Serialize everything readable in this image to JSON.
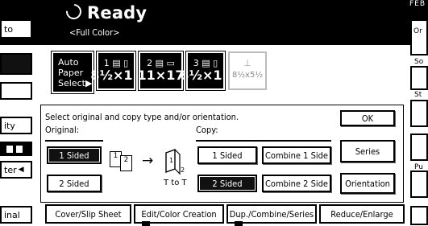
{
  "header": {
    "status": "Ready",
    "color_mode": "<Full Color>",
    "corner_label": "FEB"
  },
  "left_column": {
    "items": [
      "to",
      "",
      "",
      "ity",
      "",
      "ter",
      "inal"
    ]
  },
  "right_column": {
    "top_label": "Or",
    "label_so": "So",
    "label_st": "St",
    "label_pu": "Pu"
  },
  "paper": {
    "auto_label_line1": "Auto Paper",
    "auto_label_line2": "Select",
    "trays": [
      {
        "num": "1",
        "size": "8½×11"
      },
      {
        "num": "2",
        "size": "11×17"
      },
      {
        "num": "3",
        "size": "8½×11"
      },
      {
        "num": "",
        "size": "8½x5½"
      }
    ]
  },
  "panel": {
    "instruction": "Select original and copy type and/or orientation.",
    "ok_label": "OK",
    "original_label": "Original:",
    "copy_label": "Copy:",
    "original_options": [
      "1 Sided",
      "2 Sided"
    ],
    "original_selected": "1 Sided",
    "copy_options": [
      "1 Sided",
      "Combine 1 Side",
      "2 Sided",
      "Combine 2 Side"
    ],
    "copy_selected": "2 Sided",
    "series_label": "Series",
    "orientation_label": "Orientation",
    "diagram": {
      "page1": "1",
      "page2": "2",
      "out1": "1",
      "out2": "2",
      "caption": "T to T"
    }
  },
  "bottom_tabs": [
    "Cover/Slip Sheet",
    "Edit/Color Creation",
    "Dup./Combine/Series",
    "Reduce/Enlarge"
  ]
}
